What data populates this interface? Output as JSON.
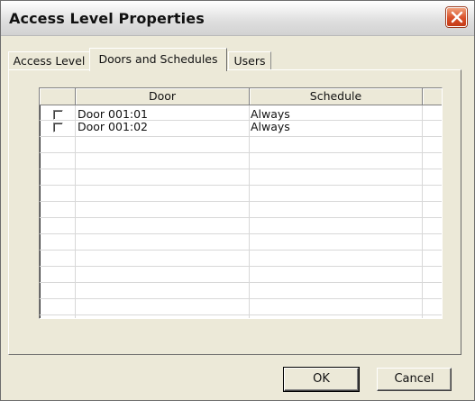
{
  "window": {
    "title": "Access Level Properties"
  },
  "icons": {
    "close": "close-icon"
  },
  "colors": {
    "dialog_bg": "#ece9d8",
    "close_button": "#d9502a"
  },
  "tabs": [
    {
      "label": "Access Level",
      "active": false
    },
    {
      "label": "Doors and Schedules",
      "active": true
    },
    {
      "label": "Users",
      "active": false
    }
  ],
  "table": {
    "columns": [
      "",
      "Door",
      "Schedule"
    ],
    "rows": [
      {
        "checked": false,
        "door": "Door 001:01",
        "schedule": "Always"
      },
      {
        "checked": false,
        "door": "Door 001:02",
        "schedule": "Always"
      }
    ]
  },
  "buttons": {
    "ok_label": "OK",
    "cancel_label": "Cancel"
  }
}
